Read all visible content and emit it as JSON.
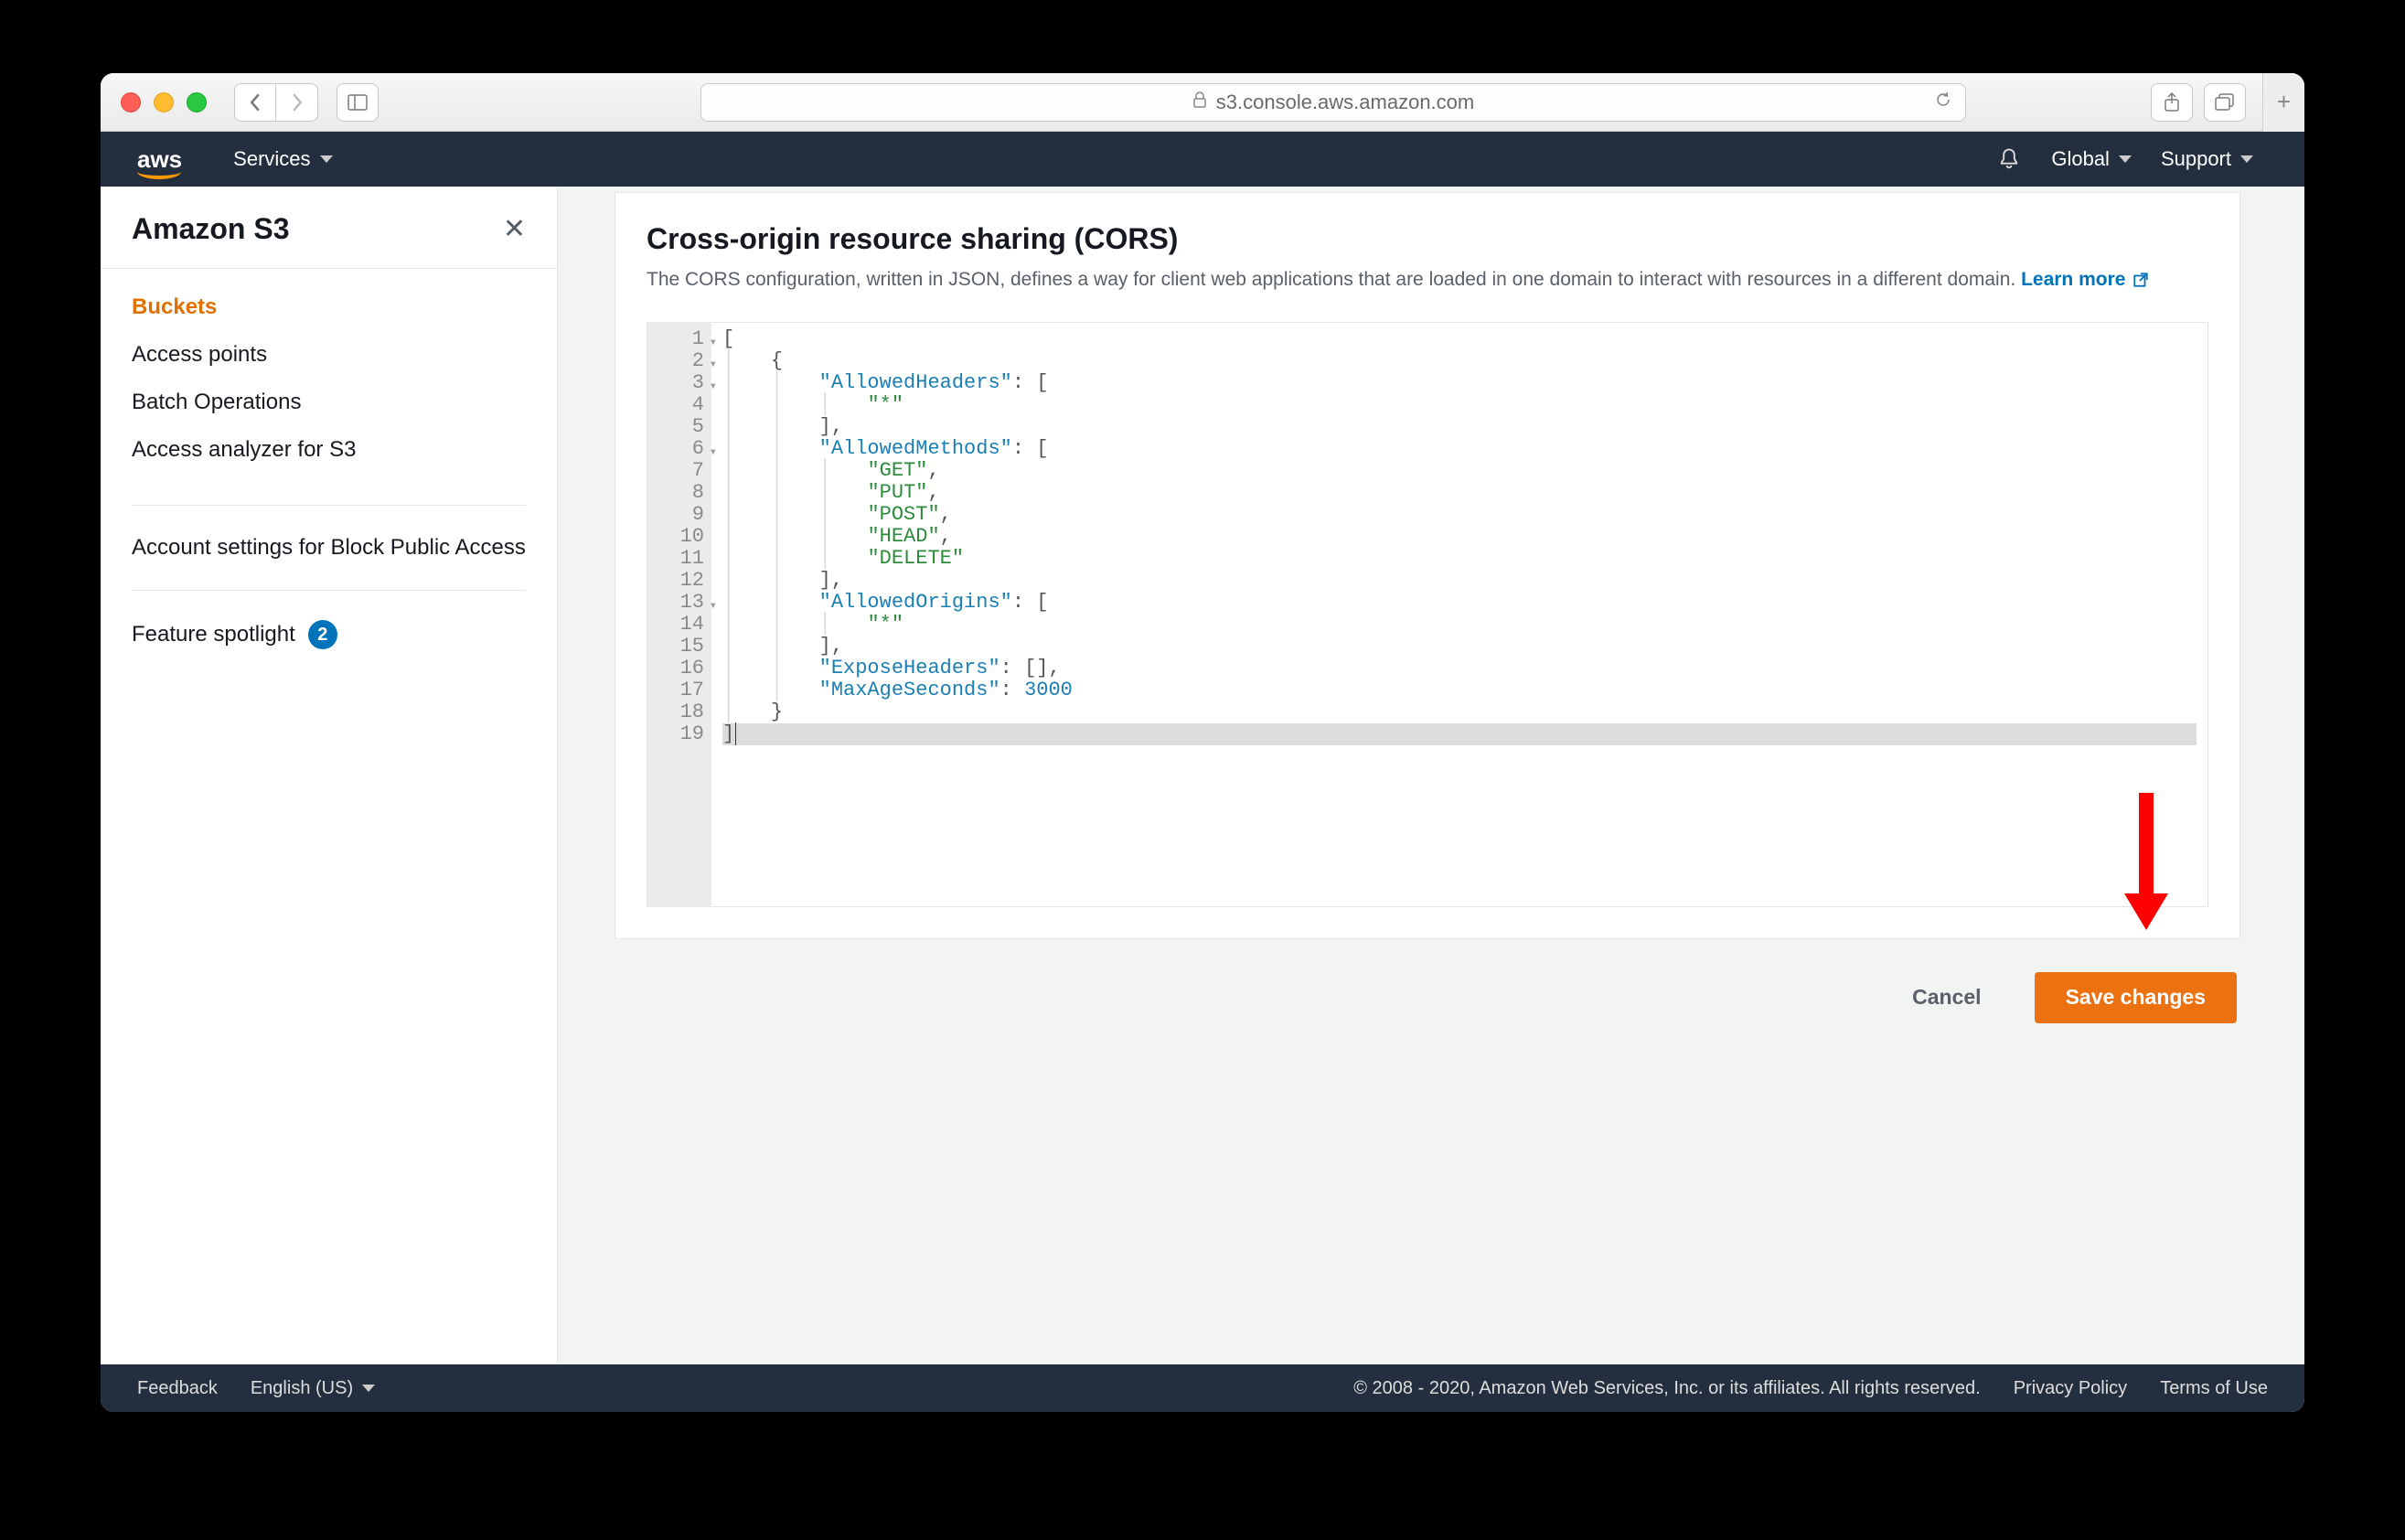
{
  "browser": {
    "url_host": "s3.console.aws.amazon.com"
  },
  "nav": {
    "logo": "aws",
    "services": "Services",
    "global": "Global",
    "support": "Support"
  },
  "sidebar": {
    "title": "Amazon S3",
    "items": [
      "Buckets",
      "Access points",
      "Batch Operations",
      "Access analyzer for S3"
    ],
    "account_block": "Account settings for Block Public Access",
    "spotlight_label": "Feature spotlight",
    "spotlight_badge": "2"
  },
  "panel": {
    "title": "Cross-origin resource sharing (CORS)",
    "desc": "The CORS configuration, written in JSON, defines a way for client web applications that are loaded in one domain to interact with resources in a different domain. ",
    "learn": "Learn more"
  },
  "editor": {
    "lines": [
      {
        "n": 1,
        "fold": true,
        "raw": "["
      },
      {
        "n": 2,
        "fold": true,
        "raw": "    {"
      },
      {
        "n": 3,
        "fold": true,
        "raw": "        \"AllowedHeaders\": ["
      },
      {
        "n": 4,
        "raw": "            \"*\""
      },
      {
        "n": 5,
        "raw": "        ],"
      },
      {
        "n": 6,
        "fold": true,
        "raw": "        \"AllowedMethods\": ["
      },
      {
        "n": 7,
        "raw": "            \"GET\","
      },
      {
        "n": 8,
        "raw": "            \"PUT\","
      },
      {
        "n": 9,
        "raw": "            \"POST\","
      },
      {
        "n": 10,
        "raw": "            \"HEAD\","
      },
      {
        "n": 11,
        "raw": "            \"DELETE\""
      },
      {
        "n": 12,
        "raw": "        ],"
      },
      {
        "n": 13,
        "fold": true,
        "raw": "        \"AllowedOrigins\": ["
      },
      {
        "n": 14,
        "raw": "            \"*\""
      },
      {
        "n": 15,
        "raw": "        ],"
      },
      {
        "n": 16,
        "raw": "        \"ExposeHeaders\": [],"
      },
      {
        "n": 17,
        "raw": "        \"MaxAgeSeconds\": 3000"
      },
      {
        "n": 18,
        "raw": "    }"
      },
      {
        "n": 19,
        "hl": true,
        "raw": "]"
      }
    ]
  },
  "actions": {
    "cancel": "Cancel",
    "save": "Save changes"
  },
  "footer": {
    "feedback": "Feedback",
    "language": "English (US)",
    "copyright": "© 2008 - 2020, Amazon Web Services, Inc. or its affiliates. All rights reserved.",
    "privacy": "Privacy Policy",
    "terms": "Terms of Use"
  }
}
